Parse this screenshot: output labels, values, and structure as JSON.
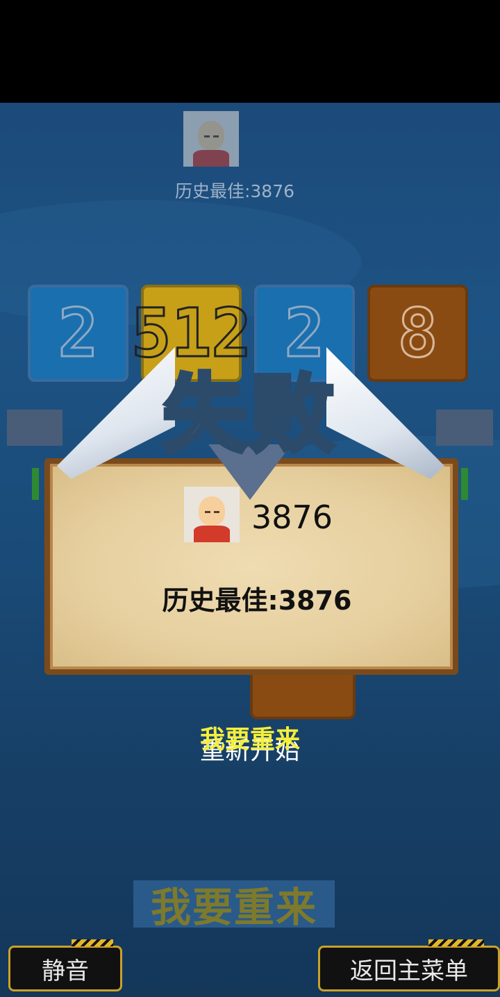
{
  "header": {
    "best_label": "历史最佳:3876"
  },
  "board": {
    "tiles": [
      "2",
      "512",
      "2",
      "8"
    ]
  },
  "result_panel": {
    "title": "失败",
    "score": "3876",
    "best_label": "历史最佳:3876"
  },
  "overlap_labels": {
    "retry": "我要重来",
    "restart": "重新开始"
  },
  "buttons": {
    "retry": "我要重来",
    "mute": "静音",
    "back_to_menu": "返回主菜单"
  },
  "colors": {
    "background": "#1c4a7a",
    "accent_yellow": "#f5ef3a",
    "tile_blue": "#1a6fae",
    "tile_gold": "#c7a018",
    "tile_brown": "#8a4b12"
  }
}
